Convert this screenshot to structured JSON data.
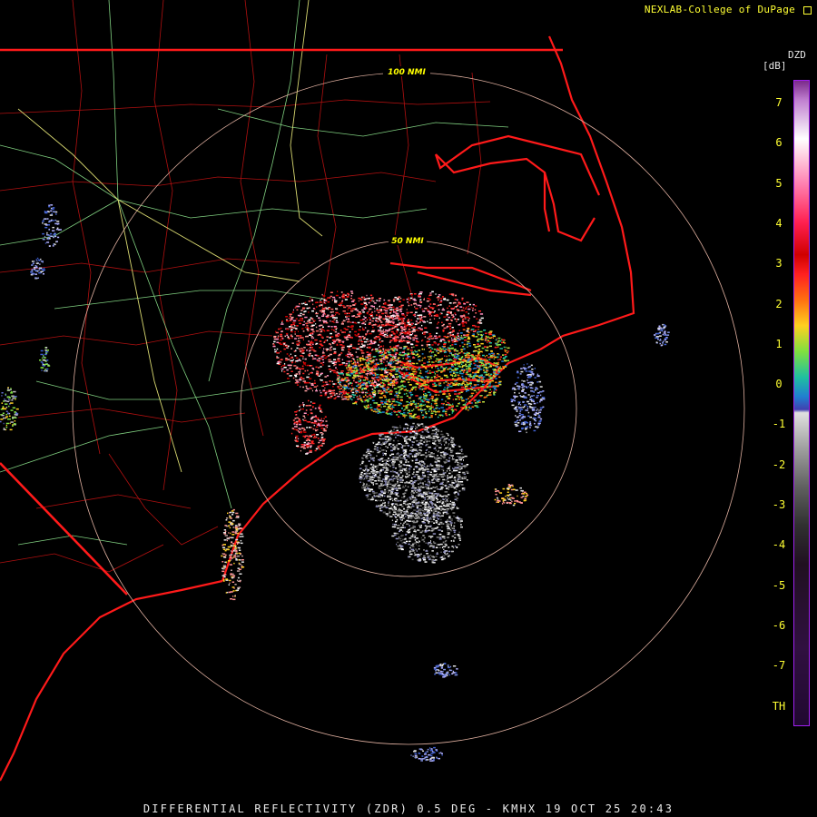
{
  "credit": "NEXLAB-College of DuPage",
  "credit_icon": "external-link-icon",
  "footer": "DIFFERENTIAL REFLECTIVITY (ZDR) 0.5 DEG - KMHX 19 OCT 25 20:43",
  "legend": {
    "product": "DZD",
    "unit": "[dB]",
    "ticks": [
      "7",
      "6",
      "5",
      "4",
      "3",
      "2",
      "1",
      "0",
      "-1",
      "-2",
      "-3",
      "-4",
      "-5",
      "-6",
      "-7",
      "TH"
    ]
  },
  "rings": [
    {
      "label": "100 NMI"
    },
    {
      "label": "50 NMI"
    }
  ],
  "colors": {
    "background": "#000000",
    "state_borders": "#ff0000",
    "county_lines": "#cc1010",
    "highways": "#90e090",
    "range_rings": "#e0b0a0",
    "legend_text": "#ffff33"
  }
}
